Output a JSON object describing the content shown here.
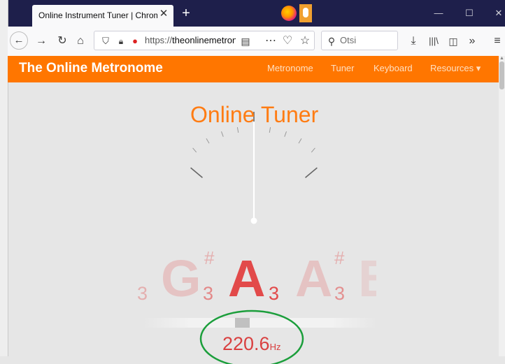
{
  "browser": {
    "tab_title": "Online Instrument Tuner | Chromatic",
    "tab_close": "✕",
    "new_tab": "+",
    "url_prefix": "https://",
    "url_domain": "theonlinemetronome",
    "search_placeholder": "Otsi",
    "window_minimize": "—",
    "window_maximize": "☐",
    "window_close": "✕"
  },
  "icons": [
    "back-arrow-icon",
    "forward-arrow-icon",
    "reload-icon",
    "home-icon",
    "shield-icon",
    "lock-icon",
    "microphone-icon",
    "reader-view-icon",
    "more-actions-icon",
    "pocket-icon",
    "bookmark-star-icon",
    "search-icon",
    "download-icon",
    "library-icon",
    "sidebar-icon",
    "overflow-icon",
    "hamburger-menu-icon",
    "firefox-icon"
  ],
  "site": {
    "brand": "The Online Metronome",
    "menu": [
      "Metronome",
      "Tuner",
      "Keyboard",
      "Resources ▾"
    ]
  },
  "tuner": {
    "title": "Online Tuner",
    "notes": [
      {
        "letter": "",
        "sub": "3",
        "sup": "",
        "opacity": 0.35
      },
      {
        "letter": "G",
        "sub": "3",
        "sup": "#",
        "opacity": 0.55
      },
      {
        "letter": "A",
        "sub": "3",
        "sup": "",
        "opacity": 1.0
      },
      {
        "letter": "A",
        "sub": "3",
        "sup": "#",
        "opacity": 0.55
      },
      {
        "letter": "B",
        "sub": "",
        "sup": "",
        "opacity": 0.2
      }
    ],
    "frequency": "220.6",
    "frequency_unit": "Hz",
    "needle_offset_cents": 0
  },
  "colors": {
    "accent": "#ff7600",
    "note": "#e24a4a",
    "title": "#ff7c13",
    "annotation": "#1b9e3b"
  }
}
